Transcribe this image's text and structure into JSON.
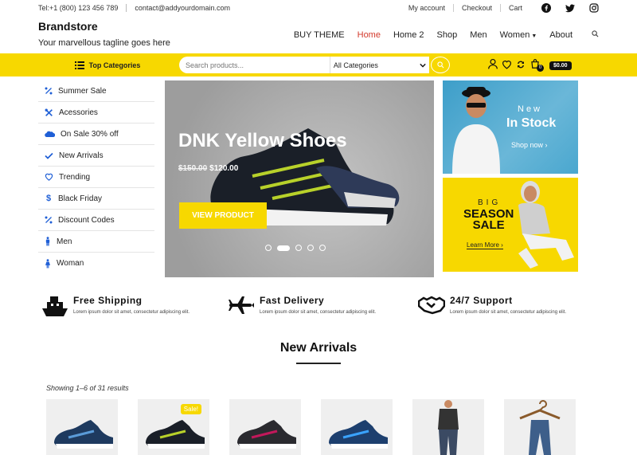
{
  "topbar": {
    "phone": "Tel:+1 (800) 123 456 789",
    "email": "contact@addyourdomain.com",
    "links": [
      "My account",
      "Checkout",
      "Cart"
    ]
  },
  "header": {
    "brand": "Brandstore",
    "tagline": "Your marvellous tagline goes here",
    "nav": [
      "BUY THEME",
      "Home",
      "Home 2",
      "Shop",
      "Men",
      "Women",
      "About"
    ],
    "active_nav": "Home"
  },
  "yellowbar": {
    "top_categories": "Top Categories",
    "search_placeholder": "Search products...",
    "category_select": "All Categories",
    "cart_count": "0",
    "cart_total": "$0.00"
  },
  "sidebar": {
    "items": [
      {
        "label": "Summer Sale",
        "icon": "percent-icon"
      },
      {
        "label": "Acessories",
        "icon": "tools-icon"
      },
      {
        "label": "On Sale 30% off",
        "icon": "salesforce-icon"
      },
      {
        "label": "New Arrivals",
        "icon": "check-icon"
      },
      {
        "label": "Trending",
        "icon": "heart-icon"
      },
      {
        "label": "Black Friday",
        "icon": "dollar-icon"
      },
      {
        "label": "Discount Codes",
        "icon": "percent-icon"
      },
      {
        "label": "Men",
        "icon": "male-icon"
      },
      {
        "label": "Woman",
        "icon": "female-icon"
      }
    ]
  },
  "hero": {
    "title": "DNK Yellow Shoes",
    "old_price": "$150.00",
    "new_price": "$120.00",
    "button": "VIEW PRODUCT",
    "slides": 5,
    "active_slide": 2
  },
  "promo1": {
    "line1": "New",
    "line2": "In Stock",
    "cta": "Shop now"
  },
  "promo2": {
    "line1": "BIG",
    "line2": "SEASON",
    "line3": "SALE",
    "cta": "Learn More"
  },
  "features": [
    {
      "title": "Free Shipping",
      "desc": "Lorem ipsum dolor sit amet, consectetur adipiscing elit.",
      "icon": "ship-icon"
    },
    {
      "title": "Fast Delivery",
      "desc": "Lorem ipsum dolor sit amet, consectetur adipiscing elit.",
      "icon": "plane-icon"
    },
    {
      "title": "24/7 Support",
      "desc": "Lorem ipsum dolor sit amet, consectetur adipiscing elit.",
      "icon": "handshake-icon"
    }
  ],
  "arrivals": {
    "heading": "New Arrivals",
    "showing": "Showing 1–6 of 31 results",
    "sale_badge": "Sale!"
  },
  "colors": {
    "accent": "#f7d800",
    "active_nav": "#d33a2c",
    "icon_blue": "#1f5fd6"
  }
}
